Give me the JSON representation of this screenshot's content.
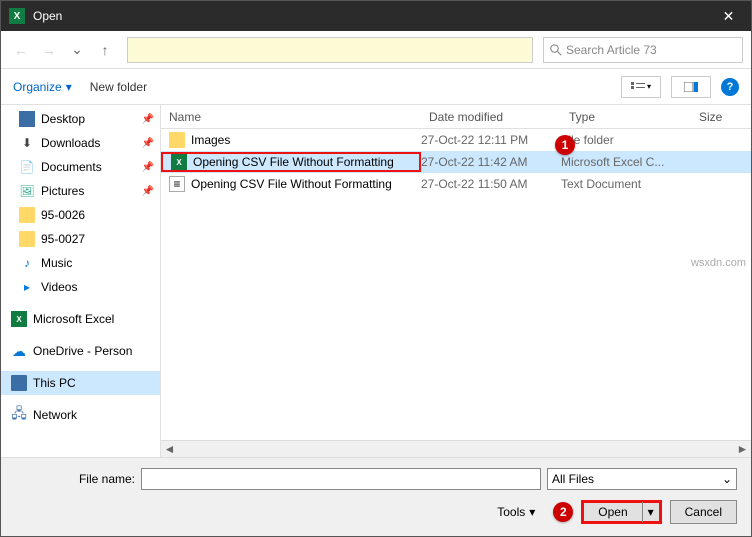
{
  "title": "Open",
  "search_placeholder": "Search Article 73",
  "toolbar": {
    "organize": "Organize",
    "newfolder": "New folder"
  },
  "columns": {
    "name": "Name",
    "date": "Date modified",
    "type": "Type",
    "size": "Size"
  },
  "sidebar": [
    {
      "label": "Desktop",
      "icon": "desktop",
      "pin": true
    },
    {
      "label": "Downloads",
      "icon": "download",
      "pin": true
    },
    {
      "label": "Documents",
      "icon": "doc",
      "pin": true
    },
    {
      "label": "Pictures",
      "icon": "pic",
      "pin": true
    },
    {
      "label": "95-0026",
      "icon": "folder",
      "pin": false
    },
    {
      "label": "95-0027",
      "icon": "folder",
      "pin": false
    },
    {
      "label": "Music",
      "icon": "music",
      "pin": false
    },
    {
      "label": "Videos",
      "icon": "video",
      "pin": false
    }
  ],
  "sidebar2": [
    {
      "label": "Microsoft Excel",
      "icon": "excel"
    },
    {
      "label": "OneDrive - Person",
      "icon": "cloud"
    },
    {
      "label": "This PC",
      "icon": "monitor",
      "selected": true
    },
    {
      "label": "Network",
      "icon": "net"
    }
  ],
  "files": [
    {
      "name": "Images",
      "date": "27-Oct-22 12:11 PM",
      "type": "File folder",
      "icon": "folder"
    },
    {
      "name": "Opening CSV File Without Formatting",
      "date": "27-Oct-22 11:42 AM",
      "type": "Microsoft Excel C...",
      "icon": "excel",
      "highlighted": true
    },
    {
      "name": "Opening CSV File Without Formatting",
      "date": "27-Oct-22 11:50 AM",
      "type": "Text Document",
      "icon": "txt"
    }
  ],
  "footer": {
    "filename_label": "File name:",
    "filter": "All Files",
    "tools": "Tools",
    "open": "Open",
    "cancel": "Cancel"
  },
  "callouts": {
    "c1": "1",
    "c2": "2"
  },
  "watermark": "wsxdn.com"
}
